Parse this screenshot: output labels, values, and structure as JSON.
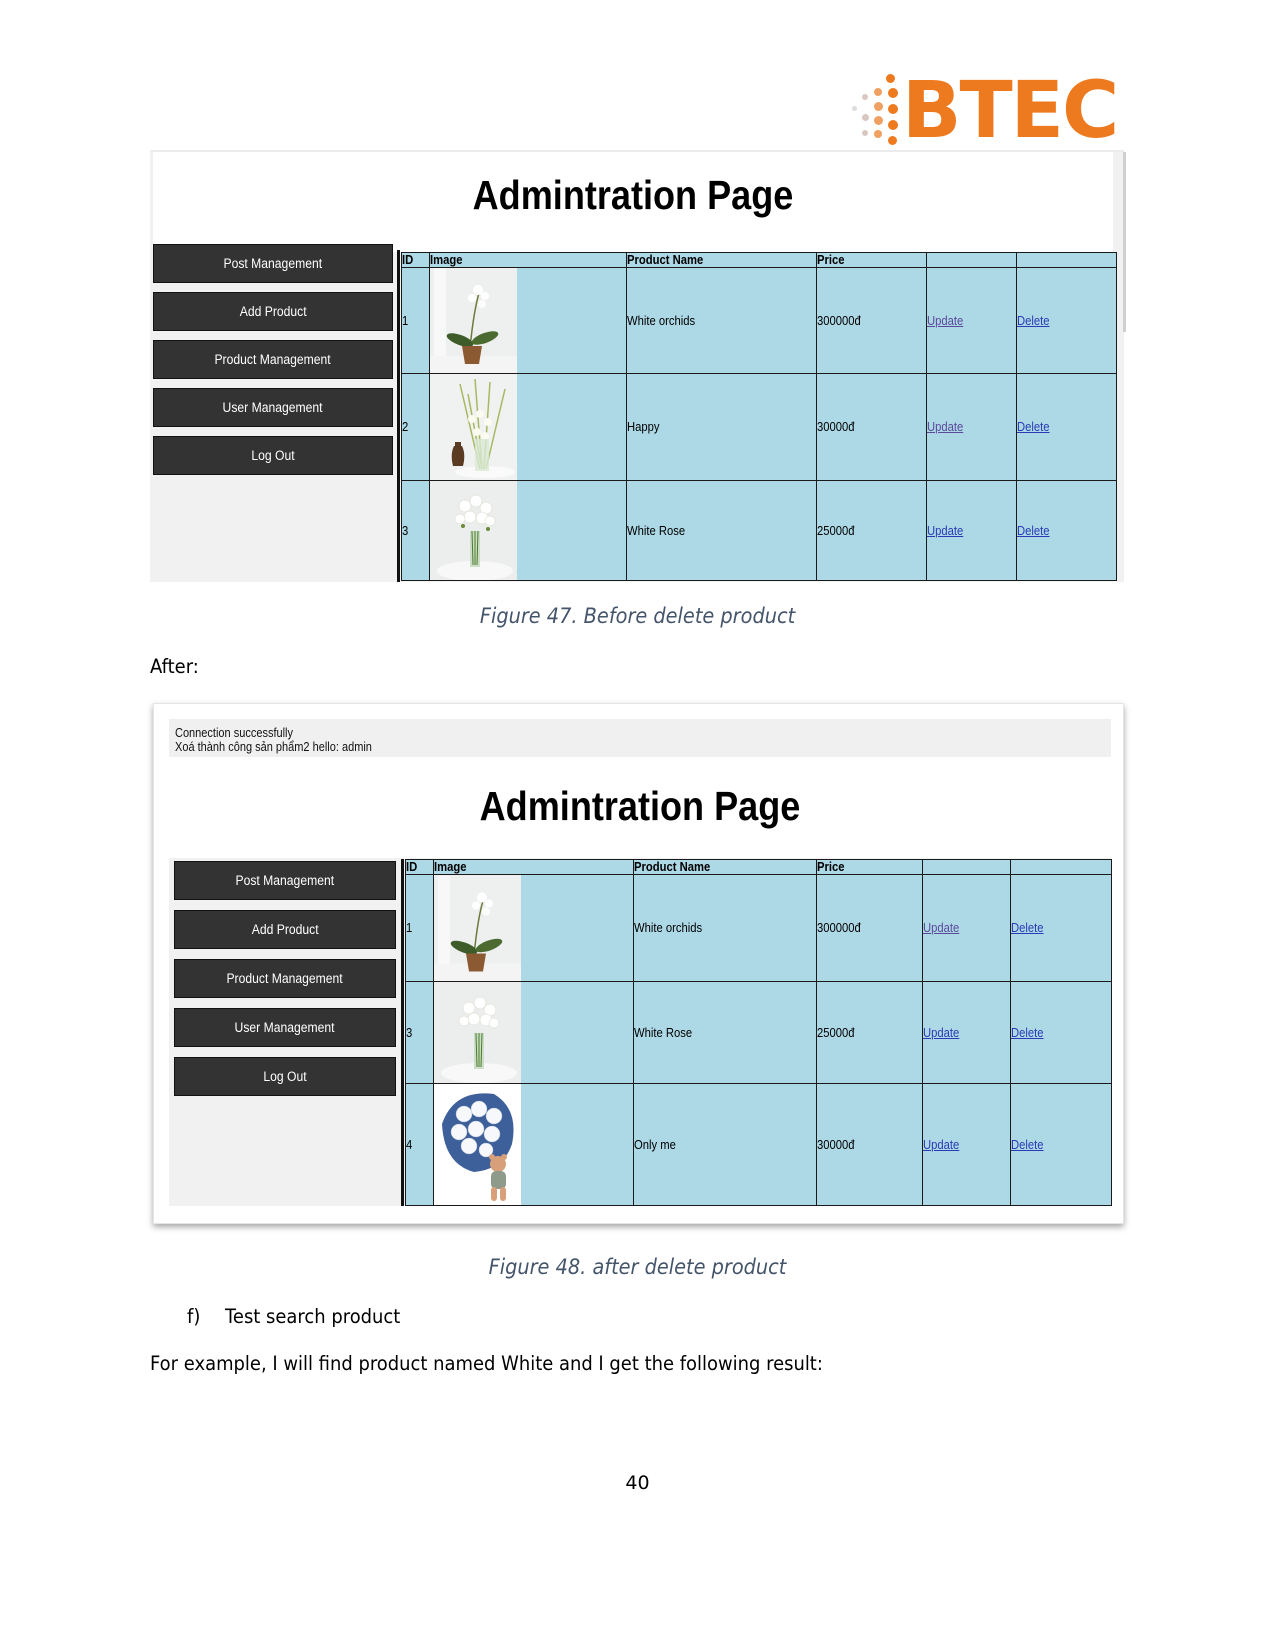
{
  "logo": {
    "text": "BTEC",
    "color": "#ee7a1f"
  },
  "figure_before": {
    "page_title": "Admintration Page",
    "sidebar": [
      {
        "label": "Post Management"
      },
      {
        "label": "Add Product"
      },
      {
        "label": "Product Management"
      },
      {
        "label": "User Management"
      },
      {
        "label": "Log Out"
      }
    ],
    "table": {
      "headers": [
        "ID",
        "Image",
        "Product Name",
        "Price",
        "",
        ""
      ],
      "rows": [
        {
          "id": "1",
          "image": "white-orchid-pot",
          "name": "White orchids",
          "price": "300000đ",
          "update": "Update",
          "delete": "Delete"
        },
        {
          "id": "2",
          "image": "gladiolus-vase-urn",
          "name": "Happy",
          "price": "30000đ",
          "update": "Update",
          "delete": "Delete"
        },
        {
          "id": "3",
          "image": "white-rose-vase",
          "name": "White Rose",
          "price": "25000đ",
          "update": "Update",
          "delete": "Delete"
        }
      ]
    },
    "caption": "Figure 47. Before delete product"
  },
  "after_label": "After:",
  "figure_after": {
    "messages": [
      "Connection successfully",
      "Xoá thành công sản phẩm2 hello: admin"
    ],
    "page_title": "Admintration Page",
    "sidebar": [
      {
        "label": "Post Management"
      },
      {
        "label": "Add Product"
      },
      {
        "label": "Product Management"
      },
      {
        "label": "User Management"
      },
      {
        "label": "Log Out"
      }
    ],
    "table": {
      "headers": [
        "ID",
        "Image",
        "Product Name",
        "Price",
        "",
        ""
      ],
      "rows": [
        {
          "id": "1",
          "image": "white-orchid-pot",
          "name": "White orchids",
          "price": "300000đ",
          "update": "Update",
          "delete": "Delete"
        },
        {
          "id": "3",
          "image": "white-rose-vase",
          "name": "White Rose",
          "price": "25000đ",
          "update": "Update",
          "delete": "Delete"
        },
        {
          "id": "4",
          "image": "bouquet-with-teddy-bear",
          "name": "Only me",
          "price": "30000đ",
          "update": "Update",
          "delete": "Delete"
        }
      ]
    },
    "caption": "Figure 48. after delete product"
  },
  "section": {
    "marker": "f)",
    "heading": "Test search product"
  },
  "paragraph": "For example, I will find product named White and I get the following result:",
  "page_number": "40",
  "colors": {
    "table_bg": "#add8e6",
    "button_bg": "#333333",
    "caption": "#44546a",
    "link": "#2a3bb5"
  }
}
